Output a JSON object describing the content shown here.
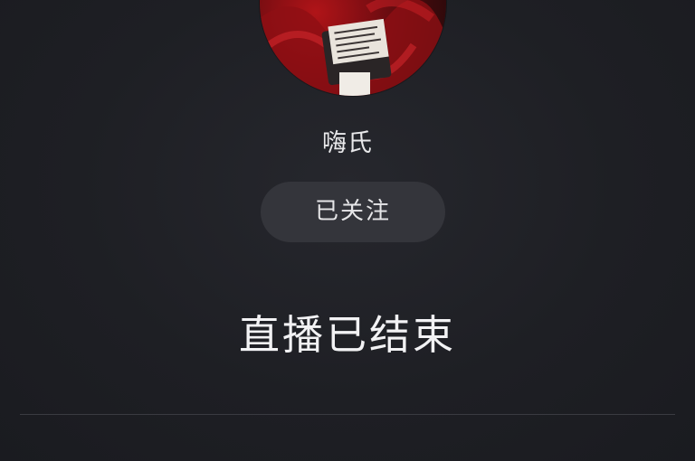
{
  "streamer": {
    "name": "嗨氏",
    "avatar_icon": "streamer-avatar"
  },
  "follow": {
    "label": "已关注"
  },
  "status": {
    "title": "直播已结束"
  },
  "colors": {
    "background": "#1e1f24",
    "button_bg": "#34353b",
    "text": "#ffffff"
  }
}
